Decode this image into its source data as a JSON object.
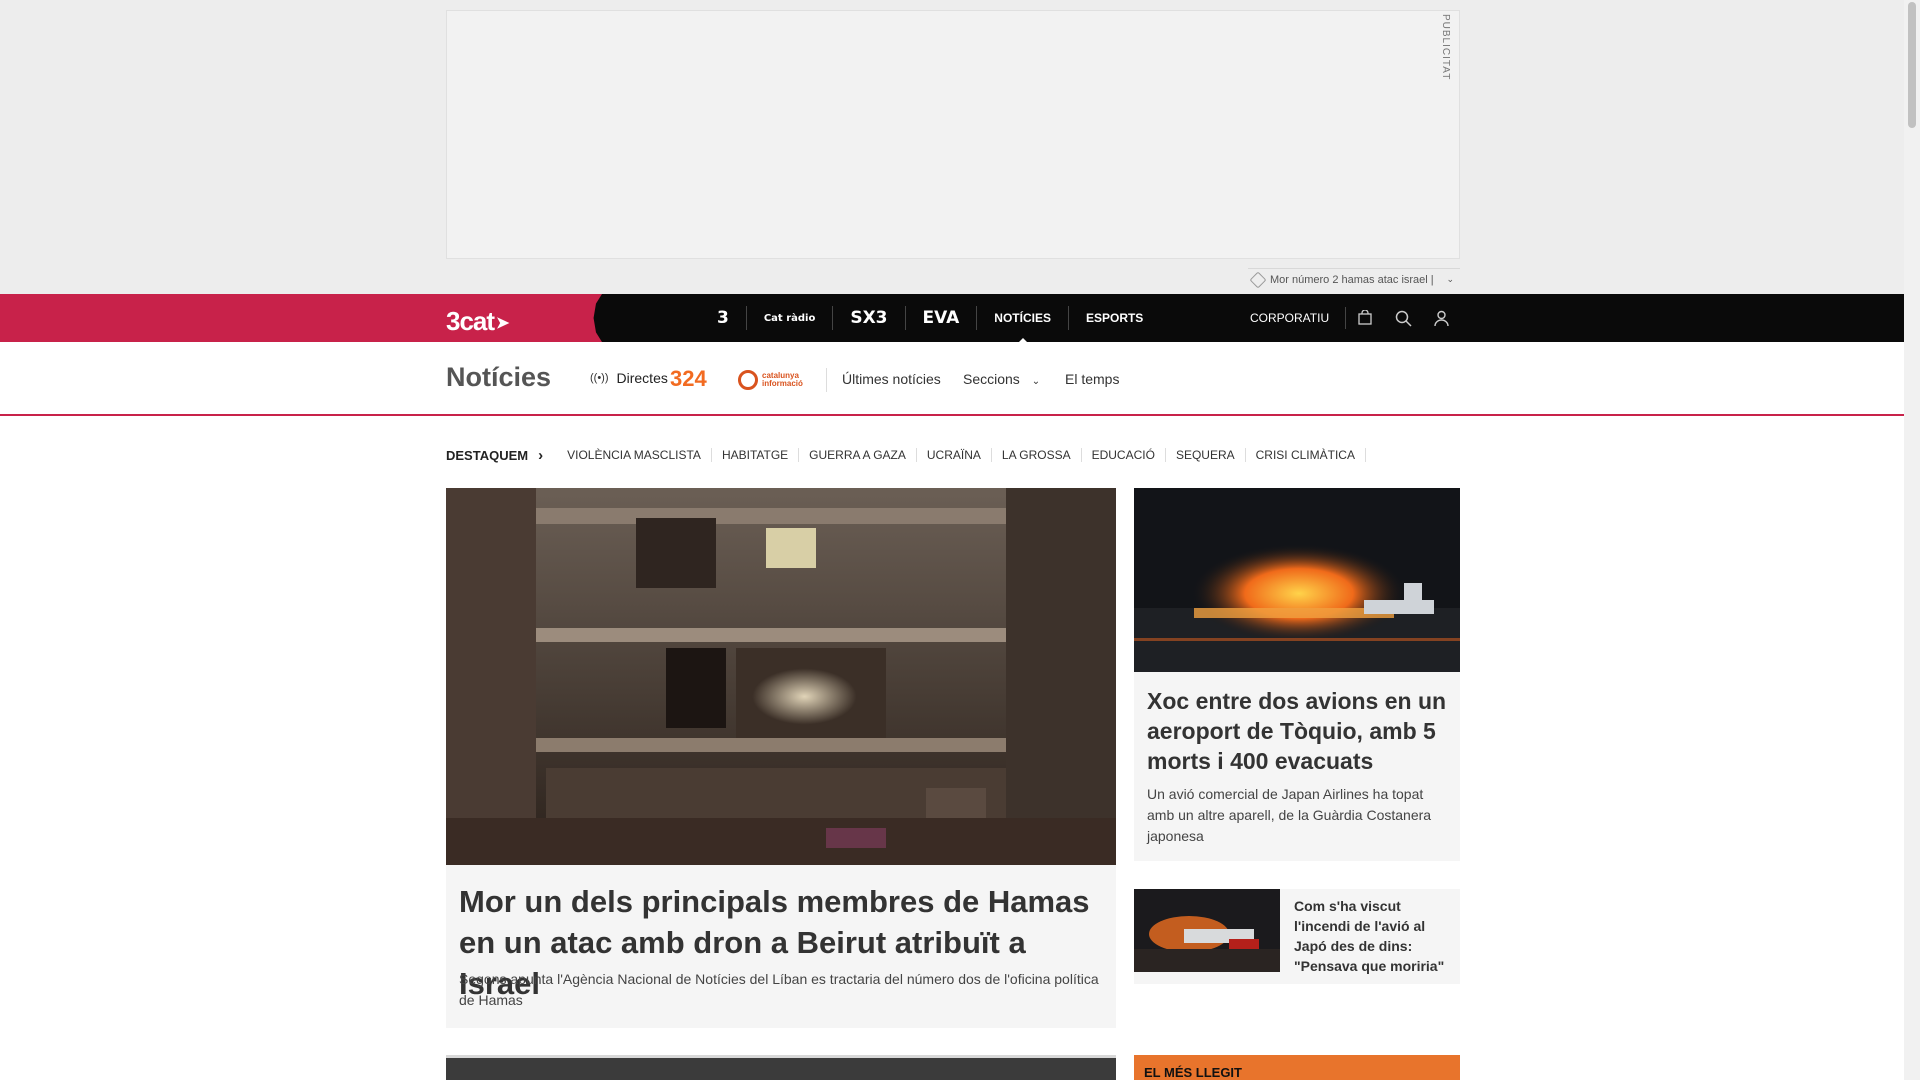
{
  "ad": {
    "label": "PUBLICITAT",
    "tag_text": "Mor número 2 hamas atac israel |"
  },
  "topbar": {
    "brand": "3cat",
    "channels": [
      "3",
      "Cat ràdio",
      "SX3",
      "EVA"
    ],
    "nav": [
      "NOTÍCIES",
      "ESPORTS"
    ],
    "corporatiu": "CORPORATIU",
    "tools": [
      "cart-icon",
      "search-icon",
      "user-icon"
    ]
  },
  "section": {
    "title": "Notícies",
    "directes": "Directes",
    "logo_324": "324",
    "logo_ci_line1": "catalunya",
    "logo_ci_line2": "informació",
    "links": [
      "Últimes notícies",
      "Seccions",
      "El temps"
    ]
  },
  "highlights": {
    "lead": "DESTAQUEM",
    "items": [
      "VIOLÈNCIA MASCLISTA",
      "HABITATGE",
      "GUERRA A GAZA",
      "UCRAÏNA",
      "LA GROSSA",
      "EDUCACIÓ",
      "SEQUERA",
      "CRISI CLIMÀTICA"
    ]
  },
  "main_story": {
    "title": "Mor un dels principals membres de Hamas en un atac amb dron a Beirut atribuït a Israel",
    "subtitle": "Segons apunta l'Agència Nacional de Notícies del Líban es tractaria del número dos de l'oficina política de Hamas"
  },
  "side_story": {
    "title": "Xoc entre dos avions en un aeroport de Tòquio, amb 5 morts i 400 evacuats",
    "subtitle": "Un avió comercial de Japan Airlines ha topat amb un altre aparell, de la Guàrdia Costanera japonesa"
  },
  "small_story": {
    "title": "Com s'ha viscut l'incendi de l'avió al Japó des de dins: \"Pensava que moriria\""
  },
  "most_read": {
    "label": "EL MÉS LLEGIT"
  },
  "colors": {
    "brand": "#c8224a",
    "topbar": "#0a0a0a",
    "most_read": "#e8742c"
  }
}
